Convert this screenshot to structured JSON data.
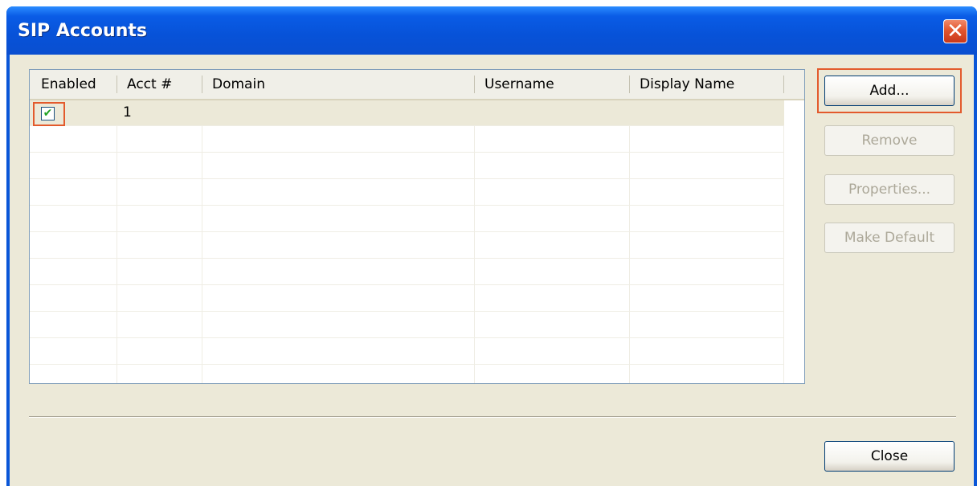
{
  "window": {
    "title": "SIP Accounts",
    "close_glyph": "✕"
  },
  "table": {
    "columns": [
      "Enabled",
      "Acct #",
      "Domain",
      "Username",
      "Display Name"
    ],
    "rows": [
      {
        "enabled": true,
        "checkbox_glyph": "✔",
        "acct": "1",
        "domain": "",
        "username": "",
        "display_name": ""
      }
    ]
  },
  "buttons": {
    "add": "Add...",
    "remove": "Remove",
    "properties": "Properties...",
    "make_default": "Make Default",
    "close": "Close"
  },
  "colors": {
    "title_bar": "#0a56d8",
    "dialog_bg": "#ece9d8",
    "highlight": "#e35a2c",
    "check": "#21a121"
  }
}
